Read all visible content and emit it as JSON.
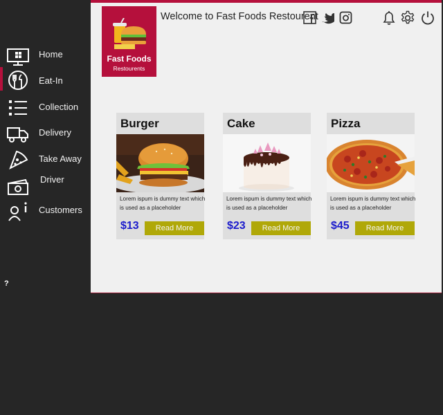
{
  "sidebar": {
    "items": [
      {
        "label": "Home",
        "icon": "monitor-icon"
      },
      {
        "label": "Eat-In",
        "icon": "fork-knife-icon"
      },
      {
        "label": "Collection",
        "icon": "list-icon"
      },
      {
        "label": "Delivery",
        "icon": "truck-icon"
      },
      {
        "label": "Take Away",
        "icon": "pizza-slice-icon"
      },
      {
        "label": "Driver",
        "icon": "money-icon"
      },
      {
        "label": "Customers",
        "icon": "user-info-icon"
      }
    ],
    "active": "Eat-In",
    "help": "?"
  },
  "brand": {
    "name": "Fast Foods",
    "subtitle": "Restourents",
    "color": "#b5103c"
  },
  "header": {
    "welcome": "Welcome to Fast Foods Restourent"
  },
  "products": [
    {
      "title": "Burger",
      "description": "Lorem ispum is dummy text which is used as a placeholder",
      "price": "$13",
      "button": "Read More"
    },
    {
      "title": "Cake",
      "description": "Lorem ispum is dummy text which is used as a placeholder",
      "price": "$23",
      "button": "Read More"
    },
    {
      "title": "Pizza",
      "description": "Lorem ispum is dummy text which is used as a placeholder",
      "price": "$45",
      "button": "Read More"
    }
  ],
  "colors": {
    "accent": "#b5103c",
    "button": "#b0a808",
    "price": "#1a1acc",
    "sidebar": "#262626",
    "content": "#f0f0f0"
  }
}
